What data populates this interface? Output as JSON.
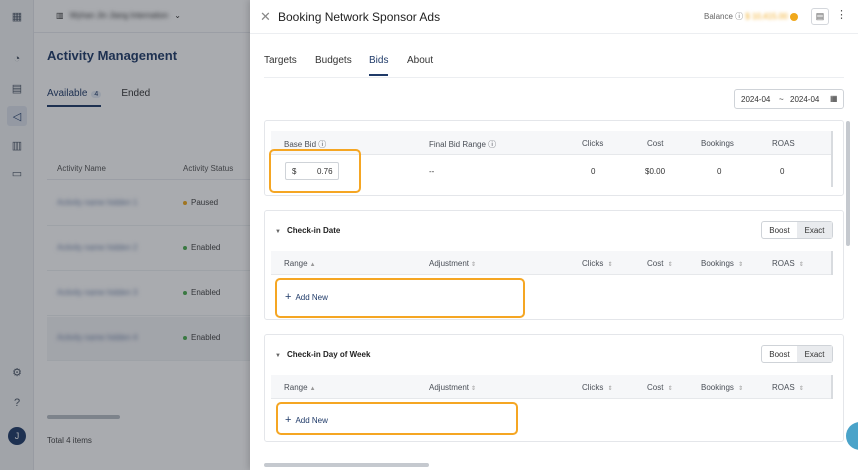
{
  "rail": {
    "icons": [
      "grid-icon",
      "dashboard-icon",
      "chart-icon",
      "megaphone-icon",
      "report-icon",
      "billing-icon",
      "settings-icon",
      "help-icon"
    ],
    "avatar": "J"
  },
  "background": {
    "account": "Wyhan Jin Jiang Internation",
    "title": "Activity Management",
    "tabs": {
      "available": "Available",
      "available_count": "4",
      "ended": "Ended"
    },
    "columns": {
      "name": "Activity Name",
      "status": "Activity Status"
    },
    "rows": [
      {
        "name": "Activity name hidden 1",
        "status": "Paused",
        "color": "#f0a81c"
      },
      {
        "name": "Activity name hidden 2",
        "status": "Enabled",
        "color": "#4caf50"
      },
      {
        "name": "Activity name hidden 3",
        "status": "Enabled",
        "color": "#4caf50"
      },
      {
        "name": "Activity name hidden 4",
        "status": "Enabled",
        "color": "#4caf50"
      }
    ],
    "total": "Total 4 items"
  },
  "drawer": {
    "title": "Booking Network Sponsor Ads",
    "balance_label": "Balance",
    "balance_value": "$ 10,415.00",
    "tabs": [
      "Targets",
      "Budgets",
      "Bids",
      "About"
    ],
    "date_range": {
      "start": "2024-04",
      "sep": "~",
      "end": "2024-04"
    },
    "base": {
      "columns": {
        "base_bid": "Base Bid",
        "final_bid_range": "Final Bid Range",
        "clicks": "Clicks",
        "cost": "Cost",
        "bookings": "Bookings",
        "roas": "ROAS"
      },
      "row": {
        "currency": "$",
        "bid": "0.76",
        "final": "--",
        "clicks": "0",
        "cost": "$0.00",
        "bookings": "0",
        "roas": "0"
      }
    },
    "checkin_date": {
      "title": "Check-in Date",
      "boost": "Boost",
      "exact": "Exact",
      "columns": {
        "range": "Range",
        "adjustment": "Adjustment",
        "clicks": "Clicks",
        "cost": "Cost",
        "bookings": "Bookings",
        "roas": "ROAS"
      },
      "add_new": "Add New"
    },
    "checkin_dow": {
      "title": "Check-in Day of Week",
      "boost": "Boost",
      "exact": "Exact",
      "columns": {
        "range": "Range",
        "adjustment": "Adjustment",
        "clicks": "Clicks",
        "cost": "Cost",
        "bookings": "Bookings",
        "roas": "ROAS"
      },
      "add_new": "Add New"
    }
  },
  "colors": {
    "accent": "#1f3a68",
    "highlight": "#f5a623",
    "paused": "#f0a81c",
    "enabled": "#4caf50"
  }
}
